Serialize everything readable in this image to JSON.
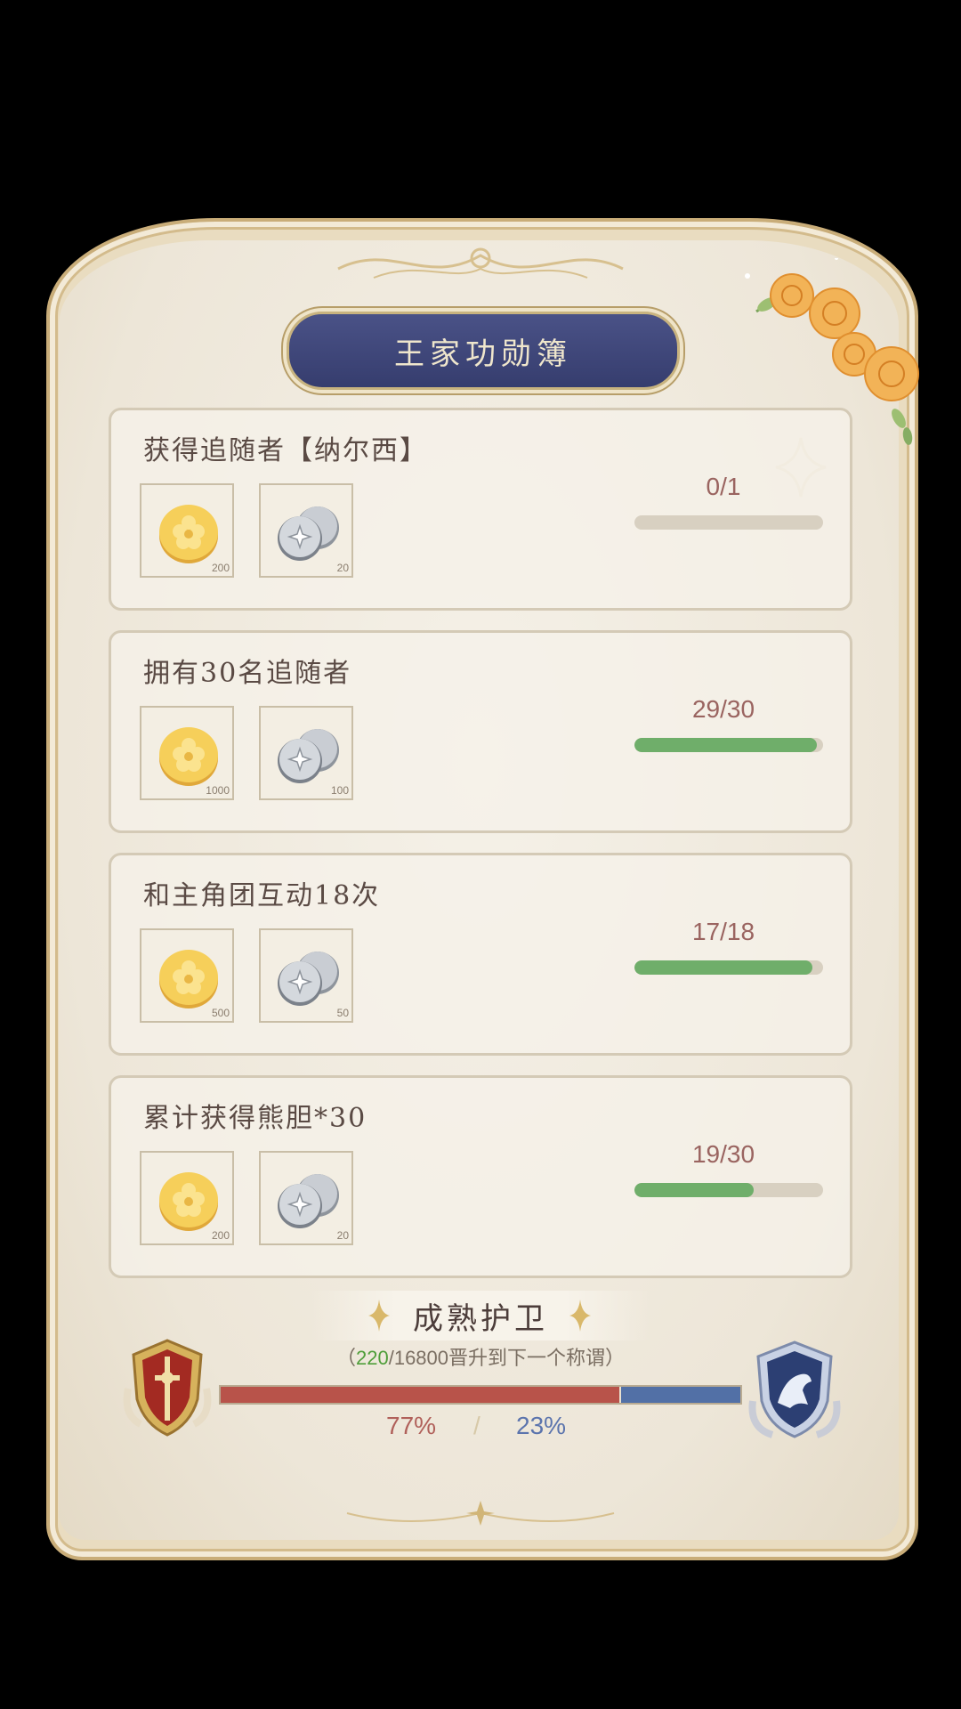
{
  "header": {
    "title": "王家功勋簿"
  },
  "tasks": [
    {
      "title": "获得追随者【纳尔西】",
      "progress_text": "0/1",
      "progress": 0.0,
      "rewards": [
        {
          "icon": "gold-coin-icon",
          "qty": "200"
        },
        {
          "icon": "silver-coins-icon",
          "qty": "20"
        }
      ]
    },
    {
      "title": "拥有30名追随者",
      "progress_text": "29/30",
      "progress": 0.967,
      "rewards": [
        {
          "icon": "gold-coin-icon",
          "qty": "1000"
        },
        {
          "icon": "silver-coins-icon",
          "qty": "100"
        }
      ]
    },
    {
      "title": "和主角团互动18次",
      "progress_text": "17/18",
      "progress": 0.944,
      "rewards": [
        {
          "icon": "gold-coin-icon",
          "qty": "500"
        },
        {
          "icon": "silver-coins-icon",
          "qty": "50"
        }
      ]
    },
    {
      "title": "累计获得熊胆*30",
      "progress_text": "19/30",
      "progress": 0.633,
      "rewards": [
        {
          "icon": "gold-coin-icon",
          "qty": "200"
        },
        {
          "icon": "silver-coins-icon",
          "qty": "20"
        }
      ]
    }
  ],
  "rank": {
    "title": "成熟护卫",
    "open_paren": "（",
    "current": "220",
    "rest": "/16800晋升到下一个称谓）",
    "left_pct": "77%",
    "separator": "/",
    "right_pct": "23%",
    "left_fraction": 0.77,
    "right_fraction": 0.23
  },
  "colors": {
    "progress_green": "#6fae6a",
    "faction_red": "#b8534a",
    "faction_blue": "#5270a6",
    "title_plate": "#3f4679"
  },
  "icons": [
    "gold-coin-icon",
    "silver-coins-icon",
    "rose-decoration-icon",
    "red-shield-emblem-icon",
    "blue-horse-emblem-icon",
    "sparkle-icon"
  ]
}
